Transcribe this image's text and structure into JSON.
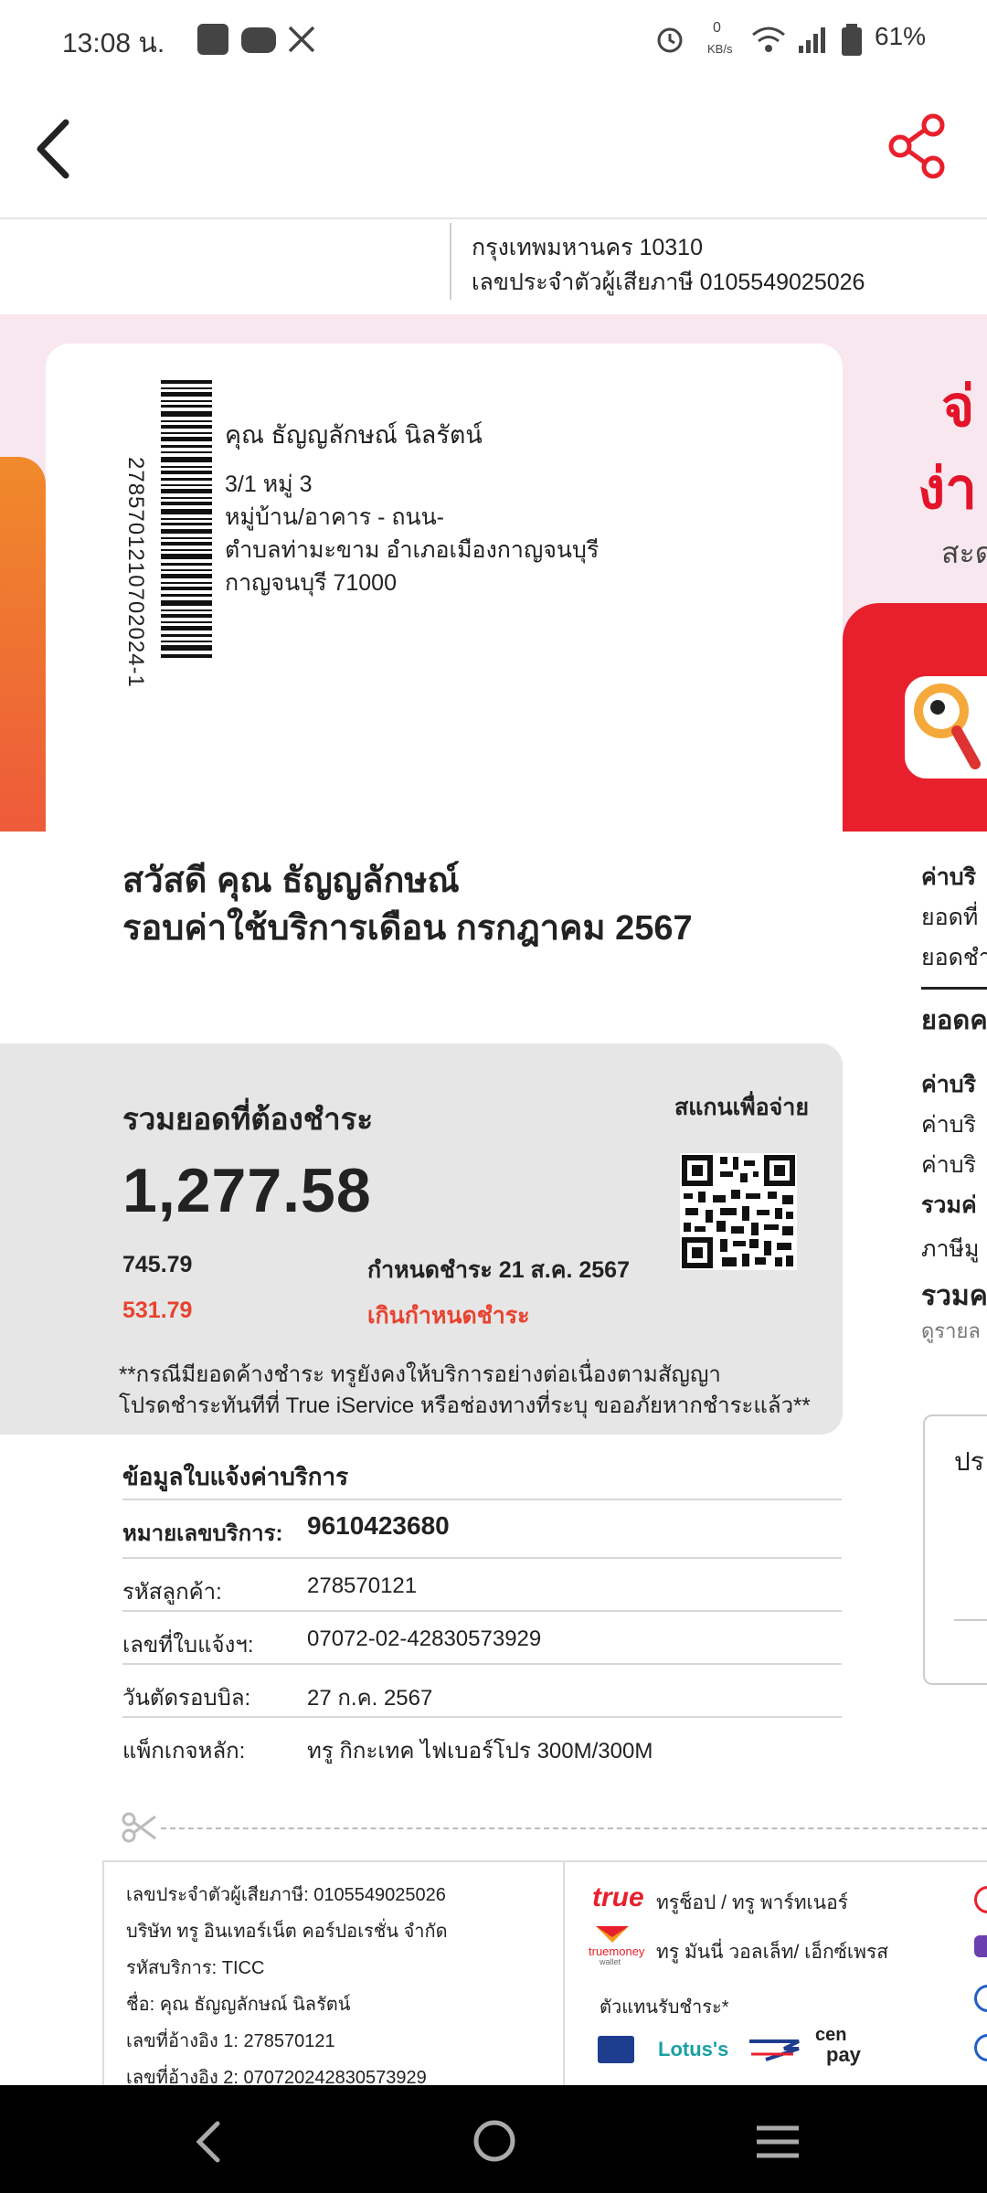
{
  "status_bar": {
    "time": "13:08 น.",
    "net_speed_top": "0",
    "net_speed_unit": "KB/s",
    "battery": "61%"
  },
  "app_bar": {
    "back": "back",
    "share": "share"
  },
  "header": {
    "address_line": "กรุงเทพมหานคร 10310",
    "tax_id_line": "เลขประจำตัวผู้เสียภาษี 0105549025026"
  },
  "address_card": {
    "barcode_number": "2785701210702024-1",
    "name": "คุณ ธัญญลักษณ์ นิลรัตน์",
    "line1": "3/1 หมู่ 3",
    "line2": "หมู่บ้าน/อาคาร - ถนน-",
    "line3": "ตำบลท่ามะขาม อำเภอเมืองกาญจนบุรี",
    "line4": "กาญจนบุรี 71000"
  },
  "promo": {
    "line1": "จ่",
    "line2": "ง่า",
    "line3": "สะด"
  },
  "greeting": {
    "hello": "สวัสดี คุณ ธัญญลักษณ์",
    "cycle": "รอบค่าใช้บริการเดือน กรกฎาคม 2567"
  },
  "summary": {
    "title": "รวมยอดที่ต้องชำระ",
    "scan_label": "สแกนเพื่อจ่าย",
    "total": "1,277.58",
    "current_amount": "745.79",
    "due_label": "กำหนดชำระ 21 ส.ค. 2567",
    "overdue_amount": "531.79",
    "overdue_label": "เกินกำหนดชำระ",
    "note_line1": "**กรณีมียอดค้างชำระ ทรูยังคงให้บริการอย่างต่อเนื่องตามสัญญา",
    "note_line2": "โปรดชำระทันทีที่ True iService หรือช่องทางที่ระบุ ขออภัยหากชำระแล้ว**"
  },
  "info": {
    "title": "ข้อมูลใบแจ้งค่าบริการ",
    "rows": [
      {
        "label": "หมายเลขบริการ:",
        "value": "9610423680"
      },
      {
        "label": "รหัสลูกค้า:",
        "value": "278570121"
      },
      {
        "label": "เลขที่ใบแจ้งฯ:",
        "value": "07072-02-42830573929"
      },
      {
        "label": "วันตัดรอบบิล:",
        "value": "27 ก.ค. 2567"
      },
      {
        "label": "แพ็กเกจหลัก:",
        "value": "ทรู กิกะเทค ไฟเบอร์โปร 300M/300M"
      }
    ]
  },
  "right_column": {
    "r1": "ค่าบริ",
    "r2": "ยอดที่",
    "r3": "ยอดชำ",
    "r4": "ยอดค",
    "r5": "ค่าบริ",
    "r6": "ค่าบริ",
    "r7": "ค่าบริ",
    "r8": "รวมค่",
    "r9": "ภาษีมู",
    "r10": "รวมค",
    "r11": "ดูรายล",
    "r12": "ปร"
  },
  "stub": {
    "tax_id": "เลขประจำตัวผู้เสียภาษี: 0105549025026",
    "company": "บริษัท ทรู อินเทอร์เน็ต คอร์ปอเรชั่น จำกัด",
    "service_code": "รหัสบริการ: TICC",
    "name": "ชื่อ: คุณ ธัญญลักษณ์ นิลรัตน์",
    "ref1": "เลขที่อ้างอิง 1: 278570121",
    "ref2": "เลขที่อ้างอิง 2: 070720242830573929",
    "true_logo": "true",
    "true_shop": "ทรูช็อป / ทรู พาร์ทเนอร์",
    "truemoney_logo1": "truemoney",
    "truemoney_logo2": "wallet",
    "truemoney_text": "ทรู มันนี่ วอลเล็ท/ เอ็กซ์เพรส",
    "agents_label": "ตัวแทนรับชำระ*",
    "lotus": "Lotus's",
    "cenpay1": "cen",
    "cenpay2": "pay"
  },
  "colors": {
    "accent": "#e8202d",
    "pink_bg": "#f8e7ef",
    "summary_bg": "#e6e6e6",
    "overdue": "#e8432f"
  }
}
